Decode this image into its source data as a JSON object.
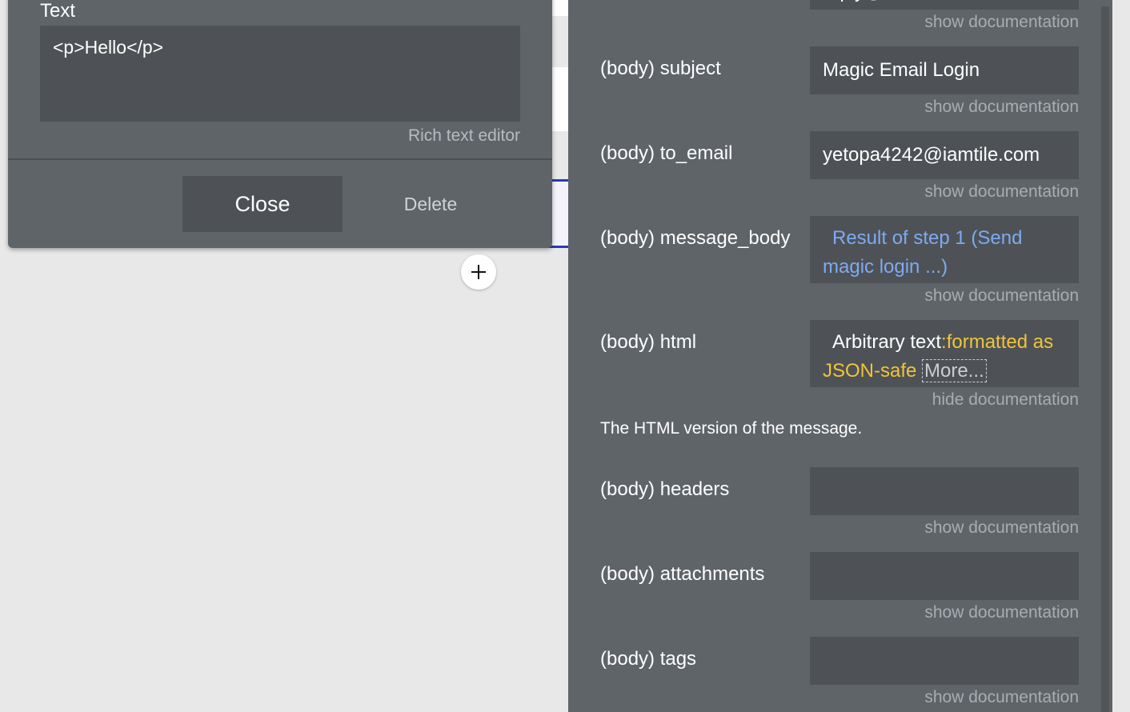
{
  "popup": {
    "field_label": "Text",
    "text_value": "<p>Hello</p>",
    "rte_link": "Rich text editor",
    "close_label": "Close",
    "delete_label": "Delete"
  },
  "panel": {
    "top_partial_value": "reply@eventsinsbhoi.com",
    "top_doc": "show documentation",
    "rows": [
      {
        "label": "(body) subject",
        "value": "Magic Email Login",
        "doc": "show documentation"
      },
      {
        "label": "(body) to_email",
        "value": "yetopa4242@iamtile.com",
        "doc": "show documentation"
      },
      {
        "label": "(body) message_body",
        "value_dynamic": "Result of step 1 (Send magic login ...)",
        "doc": "show documentation"
      },
      {
        "label": "(body) html",
        "value_static": "Arbitrary text",
        "value_format": ":formatted as JSON-safe",
        "value_more": "More...",
        "doc": "hide documentation",
        "doc_text": "The HTML version of the message."
      },
      {
        "label": "(body) headers",
        "value": "",
        "doc": "show documentation"
      },
      {
        "label": "(body) attachments",
        "value": "",
        "doc": "show documentation"
      },
      {
        "label": "(body) tags",
        "value": "",
        "doc": "show documentation"
      }
    ]
  },
  "canvas": {
    "add_icon": "plus-icon"
  }
}
